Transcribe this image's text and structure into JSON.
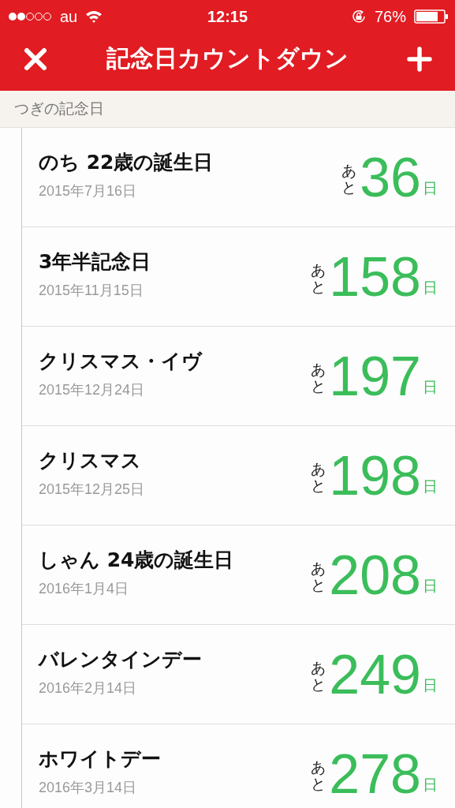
{
  "status_bar": {
    "carrier": "au",
    "time": "12:15",
    "battery": "76%"
  },
  "nav": {
    "title": "記念日カウントダウン"
  },
  "section": {
    "title": "つぎの記念日"
  },
  "events": [
    {
      "name": "のち 22歳の誕生日",
      "date": "2015年7月16日",
      "prefix": "あと",
      "days": "36",
      "unit": "日"
    },
    {
      "name": "3年半記念日",
      "date": "2015年11月15日",
      "prefix": "あと",
      "days": "158",
      "unit": "日"
    },
    {
      "name": "クリスマス・イヴ",
      "date": "2015年12月24日",
      "prefix": "あと",
      "days": "197",
      "unit": "日"
    },
    {
      "name": "クリスマス",
      "date": "2015年12月25日",
      "prefix": "あと",
      "days": "198",
      "unit": "日"
    },
    {
      "name": "しゃん 24歳の誕生日",
      "date": "2016年1月4日",
      "prefix": "あと",
      "days": "208",
      "unit": "日"
    },
    {
      "name": "バレンタインデー",
      "date": "2016年2月14日",
      "prefix": "あと",
      "days": "249",
      "unit": "日"
    },
    {
      "name": "ホワイトデー",
      "date": "2016年3月14日",
      "prefix": "あと",
      "days": "278",
      "unit": "日"
    }
  ]
}
